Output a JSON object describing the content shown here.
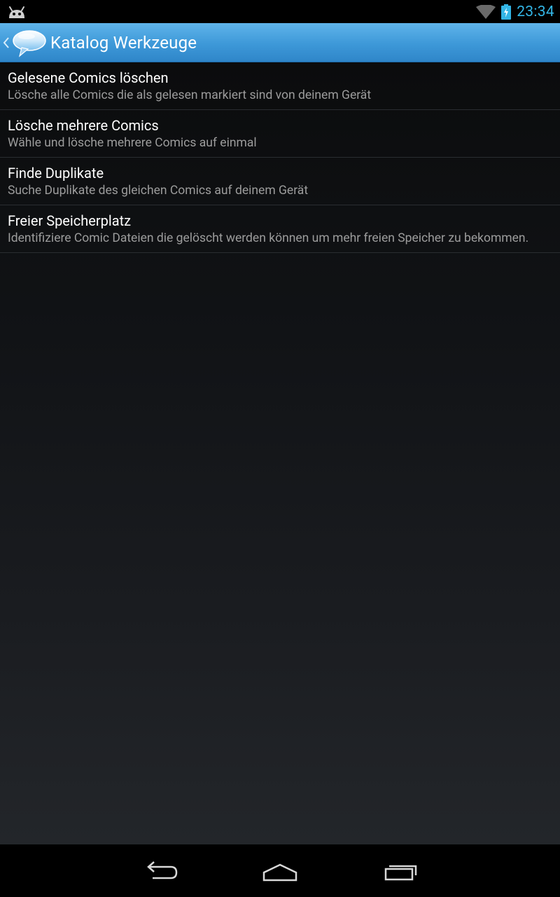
{
  "status_bar": {
    "time": "23:34",
    "left_icon": "android-notification-icon",
    "icons": [
      "wifi-icon",
      "battery-charging-icon"
    ]
  },
  "action_bar": {
    "title": "Katalog Werkzeuge",
    "up_icon": "chevron-left-icon",
    "app_icon": "speech-bubble-icon"
  },
  "tools": [
    {
      "title": "Gelesene Comics löschen",
      "summary": "Lösche alle Comics die als gelesen markiert sind von deinem Gerät"
    },
    {
      "title": "Lösche mehrere Comics",
      "summary": "Wähle und lösche mehrere Comics auf einmal"
    },
    {
      "title": "Finde Duplikate",
      "summary": "Suche Duplikate des gleichen Comics auf deinem Gerät"
    },
    {
      "title": "Freier Speicherplatz",
      "summary": "Identifiziere Comic Dateien die gelöscht werden können um mehr freien Speicher zu bekommen."
    }
  ],
  "nav_bar": {
    "buttons": [
      "back-icon",
      "home-icon",
      "recents-icon"
    ]
  },
  "colors": {
    "accent": "#33b5e5",
    "action_bar": "#3d98d8",
    "divider": "#2a2d31"
  }
}
